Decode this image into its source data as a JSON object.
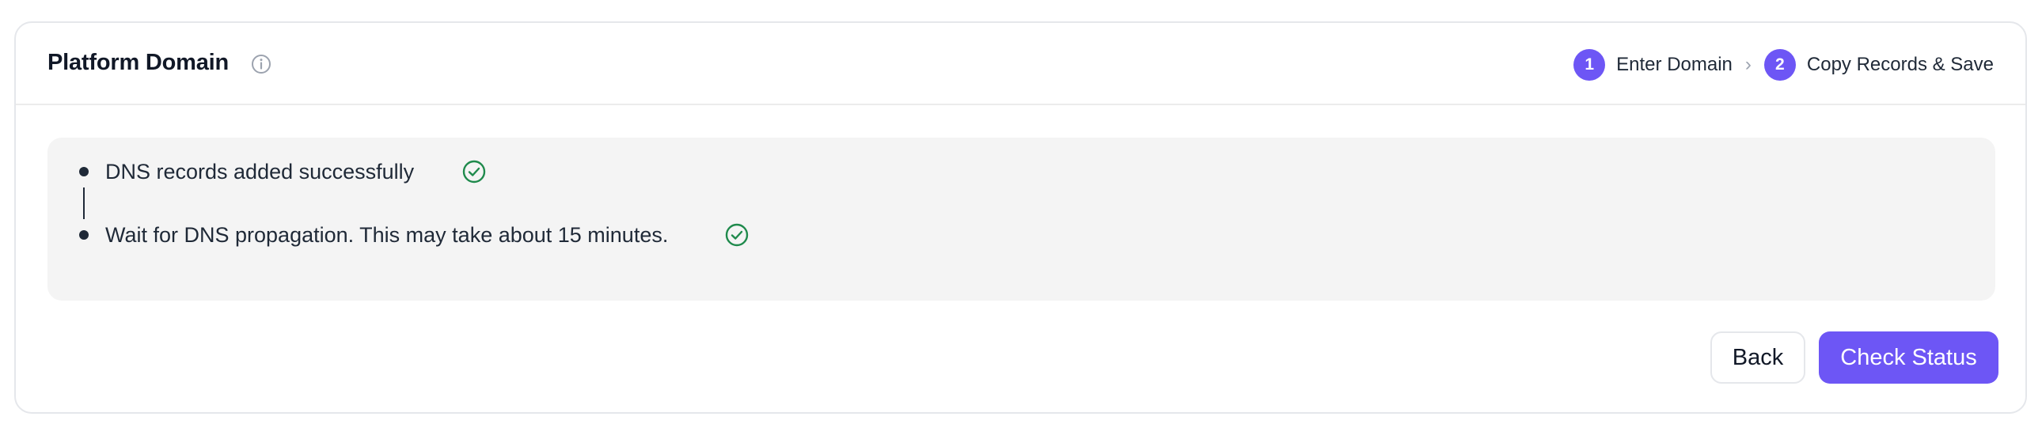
{
  "header": {
    "title": "Platform Domain",
    "info_icon": "info-icon"
  },
  "stepper": {
    "steps": [
      {
        "number": "1",
        "label": "Enter Domain"
      },
      {
        "number": "2",
        "label": "Copy Records & Save"
      }
    ],
    "separator": "›"
  },
  "status": {
    "items": [
      {
        "text": "DNS records added successfully",
        "icon": "check-circle-icon",
        "state": "complete"
      },
      {
        "text": "Wait for DNS propagation. This may take about 15 minutes.",
        "icon": "check-circle-icon",
        "state": "complete"
      }
    ]
  },
  "actions": {
    "back_label": "Back",
    "check_label": "Check Status"
  },
  "colors": {
    "accent": "#6d56f5",
    "success": "#1f8a4c",
    "panel_bg": "#f4f4f4"
  }
}
